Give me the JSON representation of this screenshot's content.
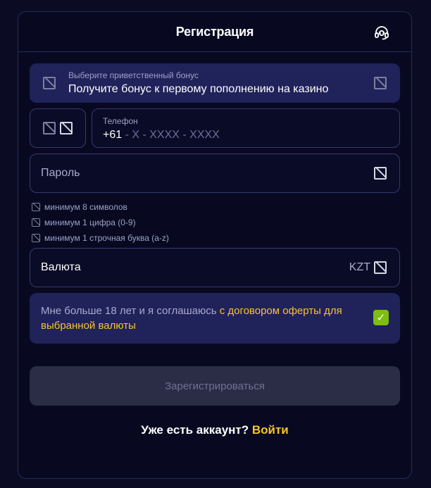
{
  "header": {
    "title": "Регистрация",
    "support_icon": "headset-icon"
  },
  "bonus": {
    "label": "Выберите приветственный бонус",
    "value": "Получите бонус к первому пополнению на казино",
    "left_icon": "gift-icon",
    "right_icon": "chevron-down-icon"
  },
  "country": {
    "flag_icon": "country-flag-icon",
    "dropdown_icon": "chevron-down-icon"
  },
  "phone": {
    "label": "Телефон",
    "prefix": "+61",
    "mask": " - X - XXXX - XXXX"
  },
  "password": {
    "placeholder": "Пароль",
    "toggle_icon": "eye-icon"
  },
  "password_rules": [
    {
      "text": "минимум 8 символов"
    },
    {
      "text": "минимум 1 цифра (0-9)"
    },
    {
      "text": "минимум 1 строчная буква (a-z)"
    }
  ],
  "currency": {
    "label": "Валюта",
    "value": "KZT",
    "dropdown_icon": "chevron-down-icon"
  },
  "consent": {
    "text": "Мне больше 18 лет и я соглашаюсь ",
    "link": "с договором оферты для выбранной валюты",
    "checked": true,
    "check_glyph": "✓"
  },
  "submit": {
    "label": "Зарегистрироваться"
  },
  "login": {
    "prompt": "Уже есть аккаунт? ",
    "link": "Войти"
  },
  "colors": {
    "background": "#0b0c24",
    "panel": "#20225a",
    "accent": "#f7c42c",
    "check": "#7ebd12",
    "button_disabled": "#2b2d46"
  }
}
